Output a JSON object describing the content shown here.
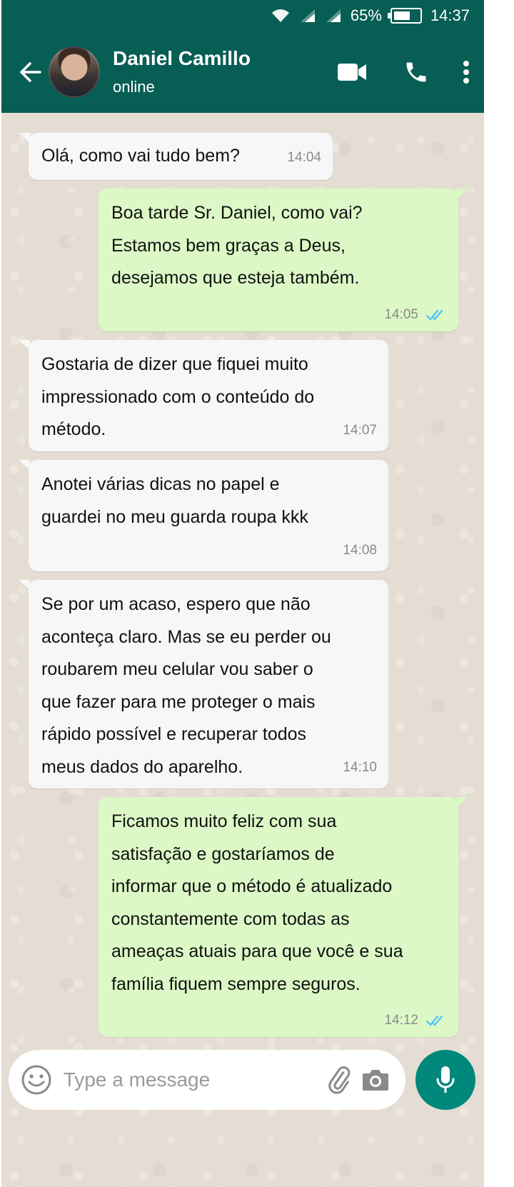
{
  "status_bar": {
    "battery": "65%",
    "battery_level": 0.65,
    "time": "14:37",
    "icons": [
      "wifi-icon",
      "signal-icon",
      "signal-icon",
      "battery-icon"
    ]
  },
  "header": {
    "contact_name": "Daniel Camillo",
    "contact_status": "online",
    "icons": [
      "back-arrow-icon",
      "video-call-icon",
      "phone-icon",
      "more-vertical-icon"
    ]
  },
  "messages": [
    {
      "direction": "incoming",
      "text": "Olá, como vai tudo bem?",
      "time": "14:04"
    },
    {
      "direction": "outgoing",
      "text": "Boa tarde Sr. Daniel, como vai?\nEstamos bem graças a Deus,\ndesejamos que esteja também.",
      "time": "14:05",
      "status": "read"
    },
    {
      "direction": "incoming",
      "text": "Gostaria de dizer que fiquei muito\nimpressionado com o conteúdo do\nmétodo.",
      "time": "14:07"
    },
    {
      "direction": "incoming",
      "text": "Anotei várias dicas no papel e\nguardei no meu guarda roupa kkk",
      "time": "14:08"
    },
    {
      "direction": "incoming",
      "text": "Se por um acaso, espero que não\naconteça claro. Mas se eu perder ou\nroubarem meu celular vou saber o\nque fazer para me proteger o mais\nrápido possível e recuperar todos\nmeus dados do aparelho.",
      "time": "14:10"
    },
    {
      "direction": "outgoing",
      "text": "Ficamos muito feliz com sua\nsatisfação e gostaríamos de\ninformar que o método é atualizado\nconstantemente com todas as\nameaças atuais para que você e sua\nfamília fiquem sempre seguros.",
      "time": "14:12",
      "status": "read"
    }
  ],
  "composer": {
    "placeholder": "Type a message",
    "icons": [
      "emoji-icon",
      "attach-icon",
      "camera-icon",
      "mic-icon"
    ]
  },
  "colors": {
    "header_bg": "#075e54",
    "outgoing_bubble": "#dcf8c6",
    "incoming_bubble": "#f7f7f7",
    "read_ticks": "#4fc3f7",
    "mic_button": "#00897b"
  }
}
